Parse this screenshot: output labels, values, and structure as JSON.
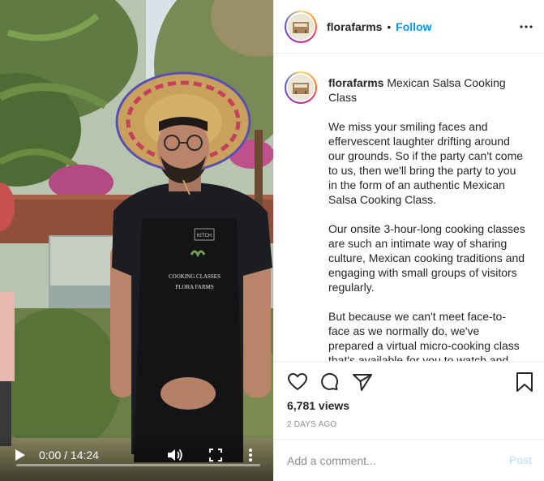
{
  "header": {
    "username": "florafarms",
    "separator": "•",
    "follow_label": "Follow"
  },
  "caption": {
    "username": "florafarms",
    "title": "Mexican Salsa Cooking Class",
    "paragraphs": [
      "We miss your smiling faces and effervescent laughter drifting around our grounds. So if the party can't come to us, then we'll bring the party to you in the form of an authentic Mexican Salsa Cooking Class.",
      "Our onsite 3-hour-long cooking classes are such an intimate way of sharing culture, Mexican cooking traditions and engaging with small groups of visitors regularly.",
      "But because we can't meet face-to-face as we normally do, we've prepared a virtual micro-cooking class that's available for you to watch and"
    ]
  },
  "stats": {
    "views": "6,781 views",
    "date": "2 DAYS AGO"
  },
  "comment": {
    "placeholder": "Add a comment...",
    "post_label": "Post"
  },
  "video": {
    "time": "0:00 / 14:24",
    "progress": 0,
    "apron_line1": "COOKING CLASSES",
    "apron_line2": "FLORA FARMS",
    "apron_pocket": "KITCH"
  },
  "icons": {
    "header_options": "more-horizontal-icon",
    "like": "heart-icon",
    "comment": "comment-icon",
    "share": "paper-plane-icon",
    "save": "bookmark-icon",
    "play": "play-icon",
    "volume": "volume-icon",
    "fullscreen": "fullscreen-icon",
    "video_more": "more-vertical-icon"
  },
  "colors": {
    "follow": "#0095f6",
    "post_disabled": "#b2dffc",
    "muted_text": "#8e8e8e",
    "border": "#efefef"
  }
}
